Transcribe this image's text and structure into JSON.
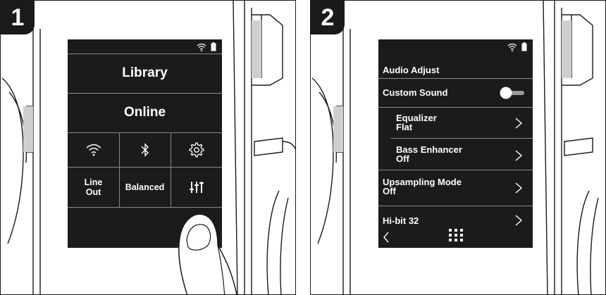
{
  "step1": {
    "number": "1",
    "menu": {
      "library_label": "Library",
      "online_label": "Online",
      "line_out_label": "Line\nOut",
      "balanced_label": "Balanced"
    },
    "icons": [
      "wifi-icon",
      "bluetooth-icon",
      "gear-icon",
      "equalizer-sliders-icon",
      "battery-icon"
    ]
  },
  "step2": {
    "number": "2",
    "header": "Audio Adjust",
    "custom_sound": {
      "label": "Custom Sound",
      "toggle_on": false
    },
    "equalizer": {
      "label": "Equalizer",
      "value": "Flat"
    },
    "bass_enhancer": {
      "label": "Bass Enhancer",
      "value": "Off"
    },
    "upsampling": {
      "label": "Upsampling Mode",
      "value": "Off"
    },
    "hibit": {
      "label": "Hi-bit 32"
    },
    "icons": [
      "wifi-icon",
      "battery-icon",
      "chevron-right-icon",
      "back-arrow-icon",
      "grid-menu-icon"
    ]
  },
  "colors": {
    "screen_bg": "#1b1b1b",
    "divider": "#8a8a8a",
    "ink": "#1a1a1a"
  }
}
